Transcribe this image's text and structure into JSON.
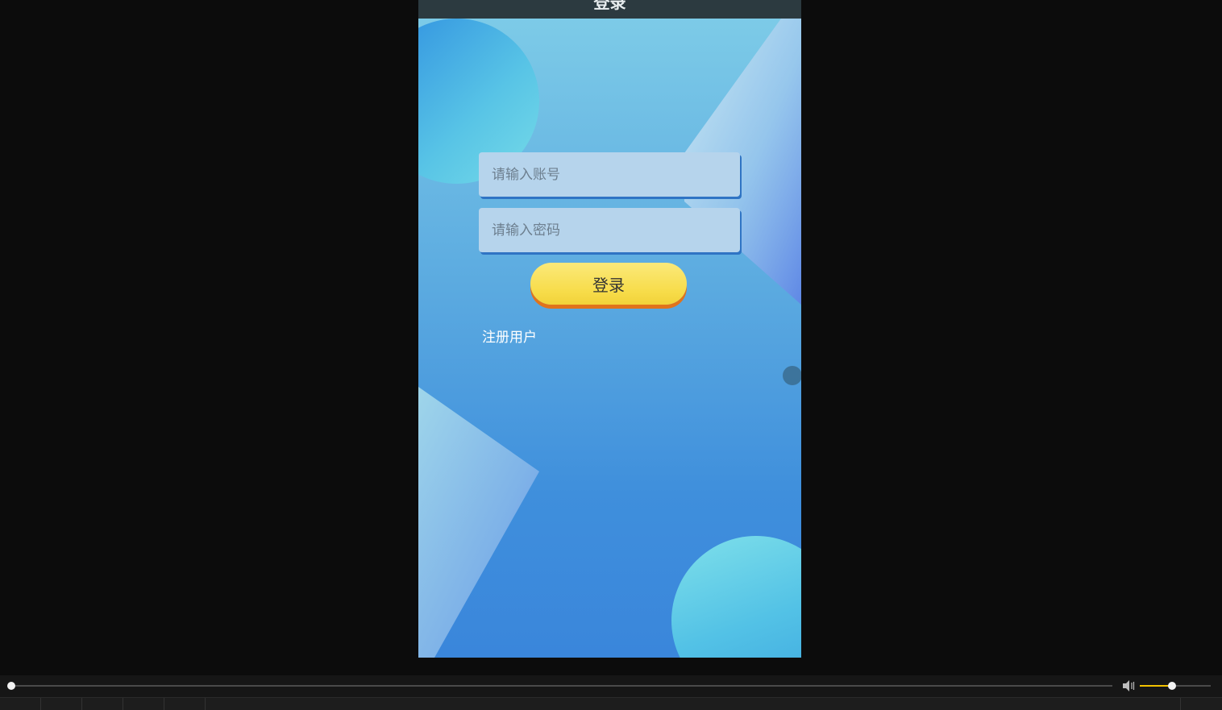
{
  "app": {
    "title": "登录"
  },
  "login_form": {
    "account_placeholder": "请输入账号",
    "password_placeholder": "请输入密码",
    "login_label": "登录",
    "register_label": "注册用户"
  },
  "player": {
    "progress_fraction": 0.0,
    "volume_fraction": 0.45,
    "volume_icon": "speaker-icon"
  },
  "colors": {
    "titlebar": "#2c3a40",
    "login_button": "#f7dc49",
    "login_button_shadow": "#e0731c",
    "volume_accent": "#f2c200"
  }
}
